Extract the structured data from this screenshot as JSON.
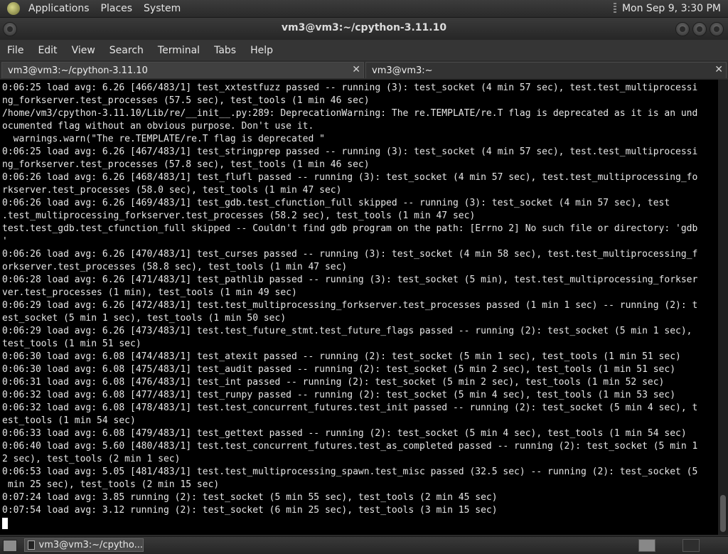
{
  "top_panel": {
    "menus": [
      "Applications",
      "Places",
      "System"
    ],
    "clock": "Mon Sep  9,  3:30 PM"
  },
  "window": {
    "title": "vm3@vm3:~/cpython-3.11.10"
  },
  "menubar": [
    "File",
    "Edit",
    "View",
    "Search",
    "Terminal",
    "Tabs",
    "Help"
  ],
  "tabs": [
    {
      "label": "vm3@vm3:~/cpython-3.11.10",
      "active": true
    },
    {
      "label": "vm3@vm3:~",
      "active": false
    }
  ],
  "terminal": {
    "lines": [
      "0:06:25 load avg: 6.26 [466/483/1] test_xxtestfuzz passed -- running (3): test_socket (4 min 57 sec), test.test_multiprocessi",
      "ng_forkserver.test_processes (57.5 sec), test_tools (1 min 46 sec)",
      "/home/vm3/cpython-3.11.10/Lib/re/__init__.py:289: DeprecationWarning: The re.TEMPLATE/re.T flag is deprecated as it is an und",
      "ocumented flag without an obvious purpose. Don't use it.",
      "  warnings.warn(\"The re.TEMPLATE/re.T flag is deprecated \"",
      "0:06:25 load avg: 6.26 [467/483/1] test_stringprep passed -- running (3): test_socket (4 min 57 sec), test.test_multiprocessi",
      "ng_forkserver.test_processes (57.8 sec), test_tools (1 min 46 sec)",
      "0:06:26 load avg: 6.26 [468/483/1] test_flufl passed -- running (3): test_socket (4 min 57 sec), test.test_multiprocessing_fo",
      "rkserver.test_processes (58.0 sec), test_tools (1 min 47 sec)",
      "0:06:26 load avg: 6.26 [469/483/1] test_gdb.test_cfunction_full skipped -- running (3): test_socket (4 min 57 sec), test",
      ".test_multiprocessing_forkserver.test_processes (58.2 sec), test_tools (1 min 47 sec)",
      "test.test_gdb.test_cfunction_full skipped -- Couldn't find gdb program on the path: [Errno 2] No such file or directory: 'gdb",
      "'",
      "0:06:26 load avg: 6.26 [470/483/1] test_curses passed -- running (3): test_socket (4 min 58 sec), test.test_multiprocessing_f",
      "orkserver.test_processes (58.8 sec), test_tools (1 min 47 sec)",
      "0:06:28 load avg: 6.26 [471/483/1] test_pathlib passed -- running (3): test_socket (5 min), test.test_multiprocessing_forkser",
      "ver.test_processes (1 min), test_tools (1 min 49 sec)",
      "0:06:29 load avg: 6.26 [472/483/1] test.test_multiprocessing_forkserver.test_processes passed (1 min 1 sec) -- running (2): t",
      "est_socket (5 min 1 sec), test_tools (1 min 50 sec)",
      "0:06:29 load avg: 6.26 [473/483/1] test.test_future_stmt.test_future_flags passed -- running (2): test_socket (5 min 1 sec),",
      "test_tools (1 min 51 sec)",
      "0:06:30 load avg: 6.08 [474/483/1] test_atexit passed -- running (2): test_socket (5 min 1 sec), test_tools (1 min 51 sec)",
      "0:06:30 load avg: 6.08 [475/483/1] test_audit passed -- running (2): test_socket (5 min 2 sec), test_tools (1 min 51 sec)",
      "0:06:31 load avg: 6.08 [476/483/1] test_int passed -- running (2): test_socket (5 min 2 sec), test_tools (1 min 52 sec)",
      "0:06:32 load avg: 6.08 [477/483/1] test_runpy passed -- running (2): test_socket (5 min 4 sec), test_tools (1 min 53 sec)",
      "0:06:32 load avg: 6.08 [478/483/1] test.test_concurrent_futures.test_init passed -- running (2): test_socket (5 min 4 sec), t",
      "est_tools (1 min 54 sec)",
      "0:06:33 load avg: 6.08 [479/483/1] test_gettext passed -- running (2): test_socket (5 min 4 sec), test_tools (1 min 54 sec)",
      "0:06:40 load avg: 5.60 [480/483/1] test.test_concurrent_futures.test_as_completed passed -- running (2): test_socket (5 min 1",
      "2 sec), test_tools (2 min 1 sec)",
      "0:06:53 load avg: 5.05 [481/483/1] test.test_multiprocessing_spawn.test_misc passed (32.5 sec) -- running (2): test_socket (5",
      " min 25 sec), test_tools (2 min 15 sec)",
      "0:07:24 load avg: 3.85 running (2): test_socket (5 min 55 sec), test_tools (2 min 45 sec)",
      "0:07:54 load avg: 3.12 running (2): test_socket (6 min 25 sec), test_tools (3 min 15 sec)"
    ]
  },
  "taskbar": {
    "task_label": "vm3@vm3:~/cpytho..."
  }
}
